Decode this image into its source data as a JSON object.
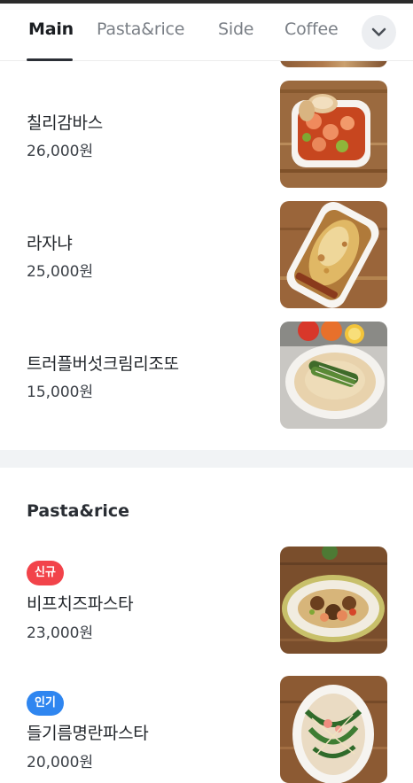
{
  "tabs": [
    {
      "label": "Main",
      "active": true
    },
    {
      "label": "Pasta&rice",
      "active": false
    },
    {
      "label": "Side",
      "active": false
    },
    {
      "label": "Coffee",
      "active": false
    }
  ],
  "icons": {
    "expand": "chevron-down-icon"
  },
  "main_items": [
    {
      "name": "칠리감바스",
      "price": "26,000원"
    },
    {
      "name": "라자냐",
      "price": "25,000원"
    },
    {
      "name": "트러플버섯크림리조또",
      "price": "15,000원"
    }
  ],
  "pasta_section": {
    "title": "Pasta&rice",
    "items": [
      {
        "badge": "신규",
        "name": "비프치즈파스타",
        "price": "23,000원"
      },
      {
        "badge": "인기",
        "name": "들기름명란파스타",
        "price": "20,000원"
      }
    ]
  },
  "colors": {
    "badge_new": "#f2434a",
    "badge_popular": "#2f86f0"
  }
}
